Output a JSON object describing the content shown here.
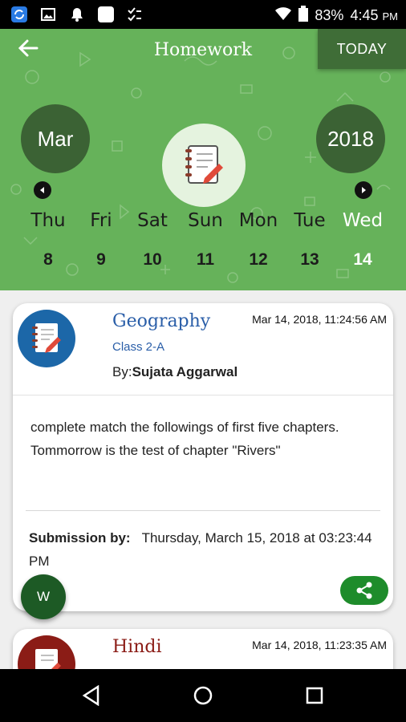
{
  "status_bar": {
    "battery": "83%",
    "time": "4:45",
    "ampm": "PM"
  },
  "header": {
    "title": "Homework",
    "today_label": "TODAY",
    "month": "Mar",
    "year": "2018",
    "days": [
      {
        "label": "Thu",
        "date": "8"
      },
      {
        "label": "Fri",
        "date": "9"
      },
      {
        "label": "Sat",
        "date": "10"
      },
      {
        "label": "Sun",
        "date": "11"
      },
      {
        "label": "Mon",
        "date": "12"
      },
      {
        "label": "Tue",
        "date": "13"
      },
      {
        "label": "Wed",
        "date": "14"
      }
    ],
    "selected_day": "Wed 14"
  },
  "cards": [
    {
      "subject": "Geography",
      "class": "Class 2-A",
      "by_prefix": "By:",
      "teacher": "Sujata Aggarwal",
      "timestamp": "Mar 14, 2018, 11:24:56 AM",
      "description": "complete match the followings of first five chapters.\nTommorrow is the test of chapter \"Rivers\"",
      "submission_label": "Submission by:",
      "submission_value": "Thursday, March 15, 2018 at 03:23:44 PM",
      "icon_color": "#1c67a8"
    },
    {
      "subject": "Hindi",
      "timestamp": "Mar 14, 2018, 11:23:35 AM",
      "icon_color": "#8b1c16"
    }
  ],
  "fab_label": "W",
  "colors": {
    "header_green": "#66b25a",
    "dark_green": "#3b6234",
    "share_green": "#1e8c2b"
  }
}
